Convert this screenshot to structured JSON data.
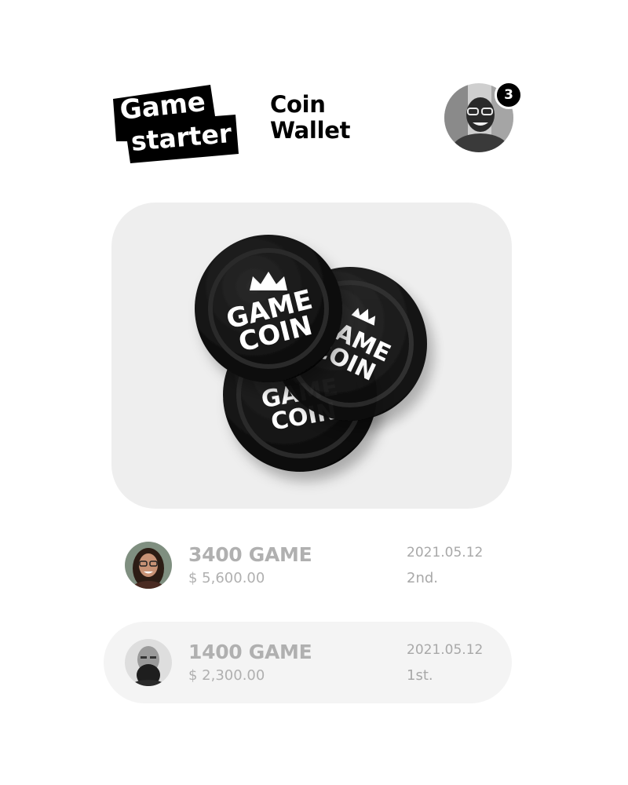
{
  "header": {
    "logo_line1": "Game",
    "logo_line2": "starter",
    "title_line1": "Coin",
    "title_line2": "Wallet",
    "notification_count": "3",
    "avatar_icon": "user-avatar-icon"
  },
  "coin_card": {
    "coin_text_line1": "GAME",
    "coin_text_line2": "COIN",
    "coin_icon": "crown-icon"
  },
  "transactions": [
    {
      "amount": "3400 GAME",
      "usd": "$ 5,600.00",
      "date": "2021.05.12",
      "rank": "2nd.",
      "highlighted": false
    },
    {
      "amount": "1400 GAME",
      "usd": "$ 2,300.00",
      "date": "2021.05.12",
      "rank": "1st.",
      "highlighted": true
    }
  ],
  "colors": {
    "primary": "#000000",
    "card_bg": "#eeeeee",
    "highlight_bg": "#f4f4f4",
    "muted_text": "#b0b0b0"
  }
}
